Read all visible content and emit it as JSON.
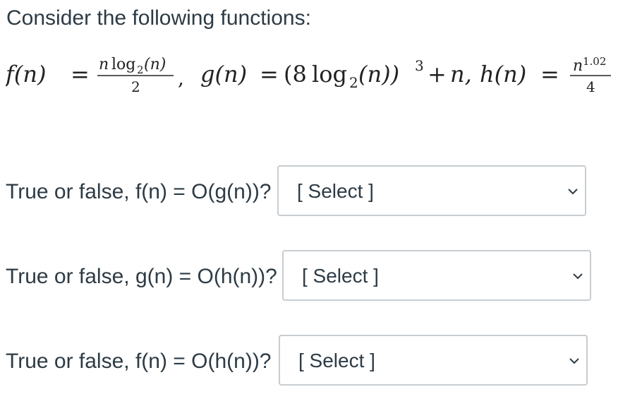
{
  "intro": "Consider the following functions:",
  "formula": {
    "f_lhs": "f(n) =",
    "f_num": "n log₂(n)",
    "f_den": "2",
    "comma1": ",",
    "g_expr": "g(n) = (8 log₂(n))³ + n,",
    "h_lhs": "h(n) =",
    "h_num": "n^1.02",
    "h_den": "4"
  },
  "questions": [
    {
      "text": "True or false, f(n) = O(g(n))?",
      "select_label": "[ Select ]"
    },
    {
      "text": "True or false, g(n) = O(h(n))?",
      "select_label": "[ Select ]"
    },
    {
      "text": "True or false, f(n) = O(h(n))?",
      "select_label": "[ Select ]"
    }
  ],
  "colors": {
    "text": "#2d3b45",
    "border": "#c7cdd1"
  }
}
